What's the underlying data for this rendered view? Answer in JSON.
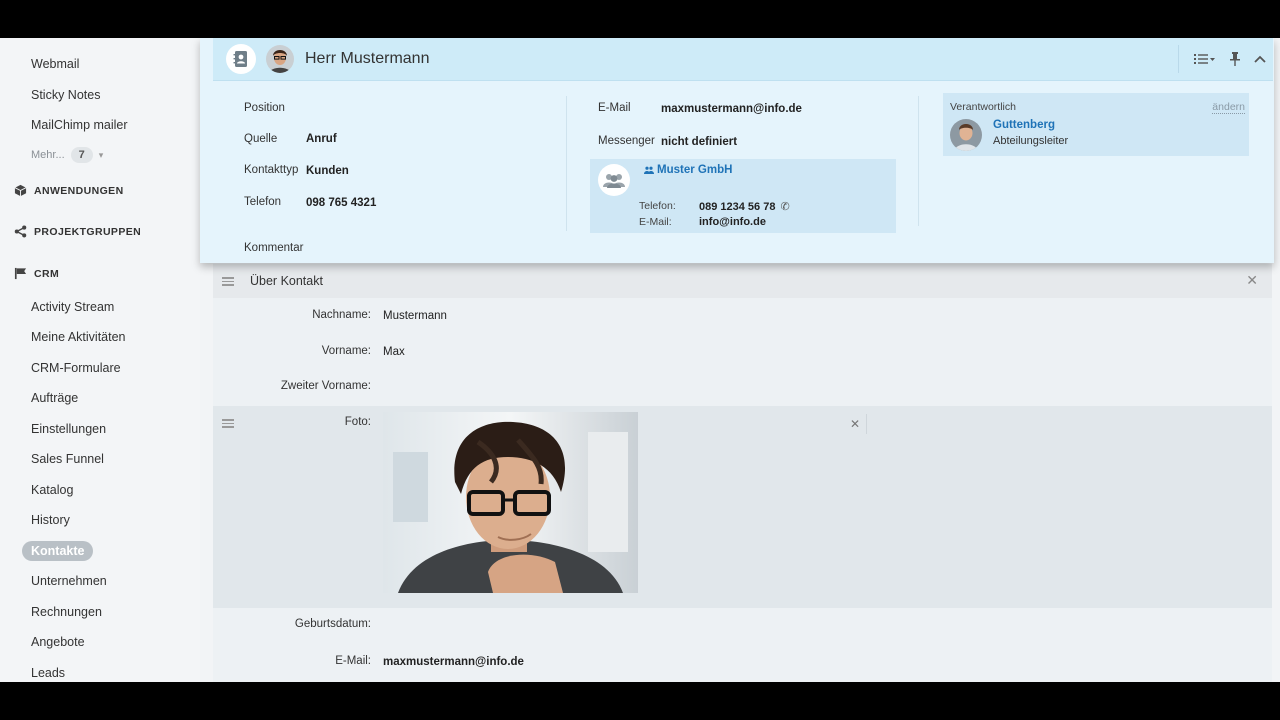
{
  "sidebar": {
    "items_top": [
      "Webmail",
      "Sticky Notes",
      "MailChimp mailer"
    ],
    "more_label": "Mehr...",
    "more_count": "7",
    "sections": [
      "ANWENDUNGEN",
      "PROJEKTGRUPPEN",
      "CRM"
    ],
    "crm_items": [
      "Activity Stream",
      "Meine Aktivitäten",
      "CRM-Formulare",
      "Aufträge",
      "Einstellungen",
      "Sales Funnel",
      "Katalog",
      "History"
    ],
    "active_item": "Kontakte",
    "crm_items_after": [
      "Unternehmen",
      "Rechnungen",
      "Angebote",
      "Leads"
    ]
  },
  "card": {
    "title": "Herr Mustermann",
    "fields_left": [
      {
        "label": "Position",
        "value": ""
      },
      {
        "label": "Quelle",
        "value": "Anruf"
      },
      {
        "label": "Kontakttyp",
        "value": "Kunden"
      },
      {
        "label": "Telefon",
        "value": "098 765 4321"
      },
      {
        "label": "Kommentar",
        "value": ""
      }
    ],
    "fields_mid": [
      {
        "label": "E-Mail",
        "value": "maxmustermann@info.de"
      },
      {
        "label": "Messenger",
        "value": "nicht definiert"
      }
    ],
    "company": {
      "name": "Muster GmbH",
      "phone_label": "Telefon:",
      "phone": "089 1234 56 78",
      "email_label": "E-Mail:",
      "email": "info@info.de"
    },
    "responsible": {
      "label": "Verantwortlich",
      "change": "ändern",
      "name": "Guttenberg",
      "role": "Abteilungsleiter"
    }
  },
  "about": {
    "title": "Über Kontakt",
    "fields": [
      {
        "label": "Nachname:",
        "value": "Mustermann"
      },
      {
        "label": "Vorname:",
        "value": "Max"
      },
      {
        "label": "Zweiter Vorname:",
        "value": ""
      },
      {
        "label": "Foto:",
        "value": ""
      },
      {
        "label": "Geburtsdatum:",
        "value": ""
      },
      {
        "label": "E-Mail:",
        "value": "maxmustermann@info.de"
      }
    ]
  },
  "colors": {
    "accent_link": "#1f73b7",
    "card_bg": "#e5f4fc",
    "card_header": "#ceebf8",
    "active_pill": "#b9c0c6"
  },
  "icons": [
    "contacts-book-icon",
    "list-settings-icon",
    "pin-icon",
    "collapse-icon",
    "close-icon",
    "drag-handle-icon",
    "apps-cube-icon",
    "share-icon",
    "flag-icon",
    "group-icon",
    "company-icon",
    "phone-icon"
  ]
}
